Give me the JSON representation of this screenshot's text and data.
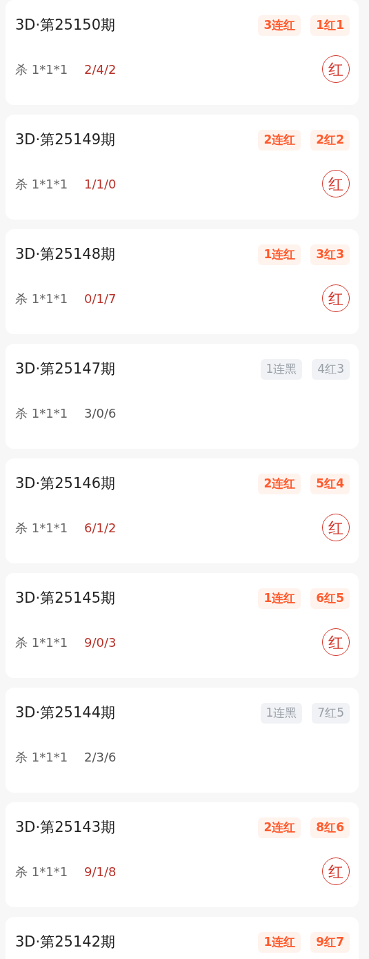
{
  "cards": [
    {
      "period": "3D·第25150期",
      "hit": true,
      "streak": "3连红",
      "count": "1红1",
      "kill": "杀 1*1*1",
      "numbers": "2/4/2",
      "result": "红"
    },
    {
      "period": "3D·第25149期",
      "hit": true,
      "streak": "2连红",
      "count": "2红2",
      "kill": "杀 1*1*1",
      "numbers": "1/1/0",
      "result": "红"
    },
    {
      "period": "3D·第25148期",
      "hit": true,
      "streak": "1连红",
      "count": "3红3",
      "kill": "杀 1*1*1",
      "numbers": "0/1/7",
      "result": "红"
    },
    {
      "period": "3D·第25147期",
      "hit": false,
      "streak": "1连黑",
      "count": "4红3",
      "kill": "杀 1*1*1",
      "numbers": "3/0/6"
    },
    {
      "period": "3D·第25146期",
      "hit": true,
      "streak": "2连红",
      "count": "5红4",
      "kill": "杀 1*1*1",
      "numbers": "6/1/2",
      "result": "红"
    },
    {
      "period": "3D·第25145期",
      "hit": true,
      "streak": "1连红",
      "count": "6红5",
      "kill": "杀 1*1*1",
      "numbers": "9/0/3",
      "result": "红"
    },
    {
      "period": "3D·第25144期",
      "hit": false,
      "streak": "1连黑",
      "count": "7红5",
      "kill": "杀 1*1*1",
      "numbers": "2/3/6"
    },
    {
      "period": "3D·第25143期",
      "hit": true,
      "streak": "2连红",
      "count": "8红6",
      "kill": "杀 1*1*1",
      "numbers": "9/1/8",
      "result": "红"
    },
    {
      "period": "3D·第25142期",
      "hit": true,
      "streak": "1连红",
      "count": "9红7"
    }
  ]
}
